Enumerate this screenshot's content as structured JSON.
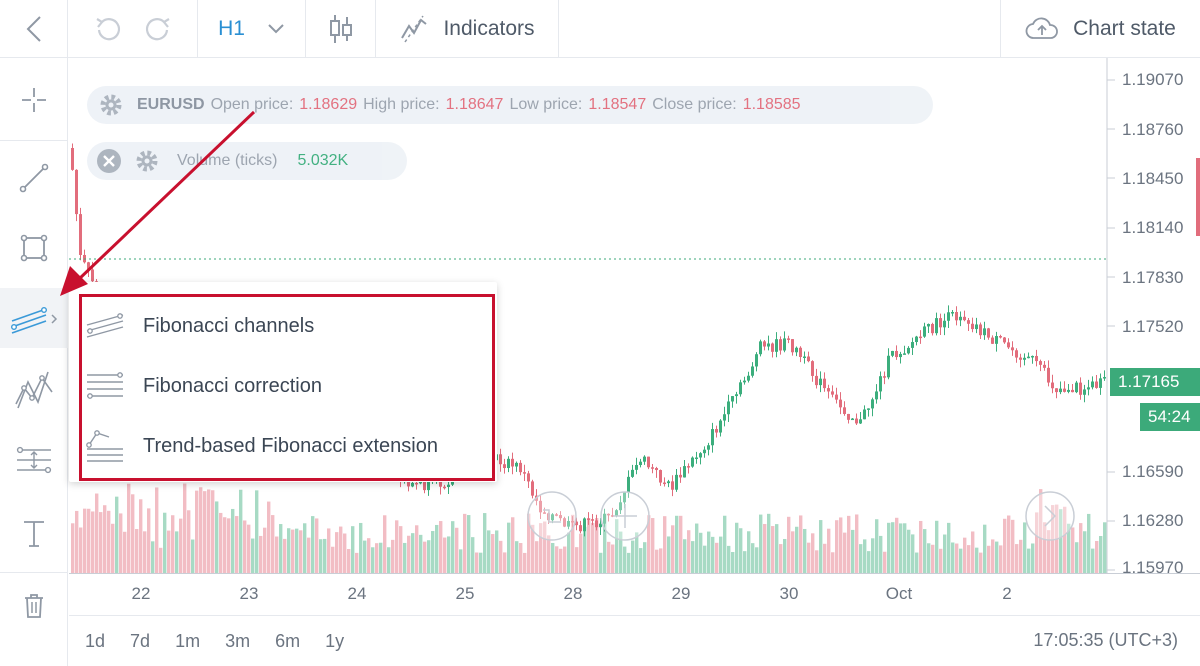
{
  "toolbar": {
    "interval": "H1",
    "indicators_label": "Indicators",
    "chart_state_label": "Chart state"
  },
  "legend": {
    "symbol": "EURUSD",
    "open_label": "Open price:",
    "open_value": "1.18629",
    "high_label": "High price:",
    "high_value": "1.18647",
    "low_label": "Low price:",
    "low_value": "1.18547",
    "close_label": "Close price:",
    "close_value": "1.18585",
    "volume_label": "Volume (ticks)",
    "volume_value": "5.032K"
  },
  "price_axis": {
    "labels": [
      "1.19070",
      "1.18760",
      "1.18450",
      "1.18140",
      "1.17830",
      "1.17520",
      "1.16590",
      "1.16280",
      "1.15970"
    ],
    "current_price": "1.17165",
    "countdown": "54:24"
  },
  "date_axis": {
    "labels": [
      "22",
      "23",
      "24",
      "25",
      "28",
      "29",
      "30",
      "Oct",
      "2"
    ]
  },
  "bottom": {
    "ranges": [
      "1d",
      "7d",
      "1m",
      "3m",
      "6m",
      "1y"
    ],
    "clock": "17:05:35 (UTC+3)"
  },
  "fib_menu": {
    "items": [
      {
        "label": "Fibonacci channels",
        "icon": "fib-channels-icon"
      },
      {
        "label": "Fibonacci correction",
        "icon": "fib-correction-icon"
      },
      {
        "label": "Trend-based Fibonacci extension",
        "icon": "fib-extension-icon"
      }
    ]
  },
  "colors": {
    "up": "#3cae7d",
    "down": "#e26d7c",
    "accent": "#2a8fd3",
    "annotation": "#c8102e"
  }
}
